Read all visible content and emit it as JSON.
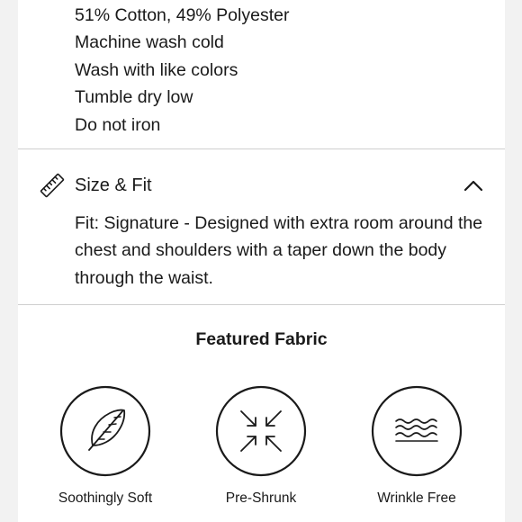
{
  "care": {
    "items": [
      "51% Cotton, 49% Polyester",
      "Machine wash cold",
      "Wash with like colors",
      "Tumble dry low",
      "Do not iron"
    ]
  },
  "size_fit": {
    "title": "Size & Fit",
    "icon": "ruler-icon",
    "expanded": true,
    "toggle_icon": "chevron-up-icon",
    "body": "Fit: Signature - Designed with extra room around the chest and shoulders with a taper down the body through the waist."
  },
  "featured_fabric": {
    "title": "Featured Fabric",
    "features": [
      {
        "label": "Soothingly Soft",
        "icon": "feather-icon"
      },
      {
        "label": "Pre-Shrunk",
        "icon": "shrink-arrows-icon"
      },
      {
        "label": "Wrinkle Free",
        "icon": "wavy-lines-icon"
      }
    ]
  },
  "colors": {
    "page_background": "#f2f2f2",
    "panel_background": "#ffffff",
    "text": "#1a1a1a",
    "divider": "#cfcfcf"
  }
}
